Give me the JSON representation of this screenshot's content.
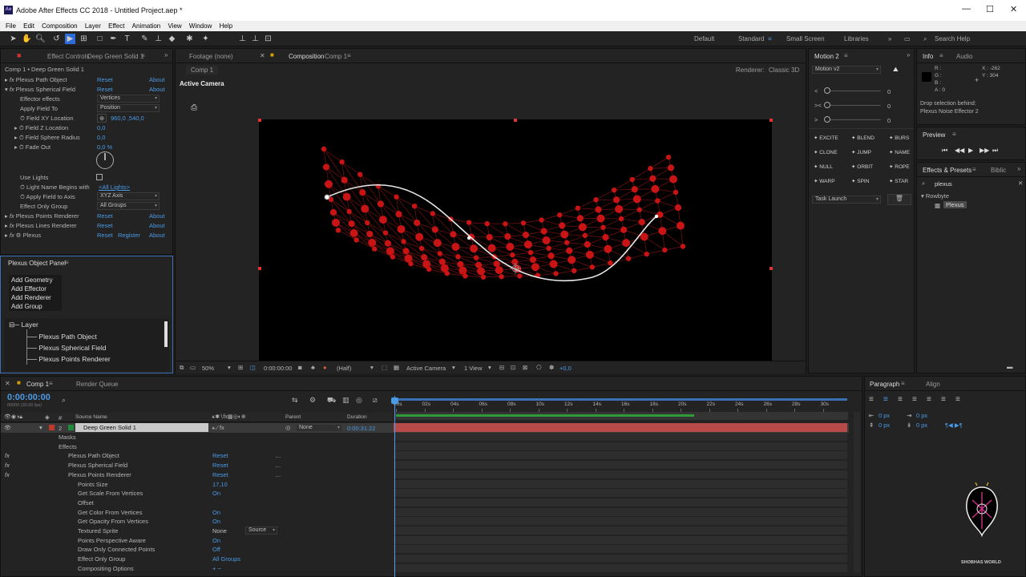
{
  "app": {
    "title": "Adobe After Effects CC 2018 - Untitled Project.aep *",
    "logo": "Ae"
  },
  "menu": [
    "File",
    "Edit",
    "Composition",
    "Layer",
    "Effect",
    "Animation",
    "View",
    "Window",
    "Help"
  ],
  "workspaces": {
    "default": "Default",
    "standard": "Standard",
    "small_screen": "Small Screen",
    "libraries": "Libraries",
    "search_help": "Search Help"
  },
  "effect_controls": {
    "tab_label": "Effect Controls",
    "layer_name": "Deep Green Solid 1",
    "breadcrumb": "Comp 1 • Deep Green Solid 1",
    "effects": [
      {
        "name": "Plexus Path Object",
        "reset": "Reset",
        "about": "About"
      },
      {
        "name": "Plexus Spherical Field",
        "reset": "Reset",
        "about": "About"
      }
    ],
    "props": {
      "effector_effects": {
        "label": "Effector effects",
        "value": "Vertices"
      },
      "apply_field_to": {
        "label": "Apply Field To",
        "value": "Position"
      },
      "field_xy": {
        "label": "Field XY Location",
        "value": "960,0 ,540,0"
      },
      "field_z": {
        "label": "Field Z Location",
        "value": "0,0"
      },
      "field_radius": {
        "label": "Field Sphere Radius",
        "value": "0,0"
      },
      "fade_out": {
        "label": "Fade Out",
        "value": "0,0 %"
      },
      "use_lights": {
        "label": "Use Lights"
      },
      "light_name": {
        "label": "Light Name Begins with",
        "value": "<All Lights>"
      },
      "apply_axis": {
        "label": "Apply Field to Axis",
        "value": "XYZ Axis"
      },
      "effect_only_group": {
        "label": "Effect Only Group",
        "value": "All Groups"
      }
    },
    "effects_after": [
      {
        "name": "Plexus Points Renderer",
        "reset": "Reset",
        "about": "About"
      },
      {
        "name": "Plexus Lines Renderer",
        "reset": "Reset",
        "about": "About"
      },
      {
        "name": "Plexus",
        "reset": "Reset",
        "register": "Register",
        "about": "About"
      }
    ]
  },
  "plexus_panel": {
    "title": "Plexus Object Panel",
    "buttons": [
      "Add Geometry",
      "Add Effector",
      "Add Renderer",
      "Add Group"
    ],
    "tree_root": "Layer",
    "tree_items": [
      "Plexus Path Object",
      "Plexus Spherical Field",
      "Plexus Points Renderer"
    ]
  },
  "composition": {
    "footage_tab": "Footage (none)",
    "comp_tab_prefix": "Composition",
    "comp_tab_name": "Comp 1",
    "comp_crumb": "Comp 1",
    "renderer_label": "Renderer:",
    "renderer_value": "Classic 3D",
    "camera_label": "Active Camera",
    "zoom": "50%",
    "timecode": "0:00:00:00",
    "resolution": "(Half)",
    "camera": "Active Camera",
    "view": "1 View",
    "exposure": "+0,0"
  },
  "motion": {
    "title": "Motion 2",
    "preset": "Motion v2",
    "sliders": [
      {
        "label": "<",
        "value": "0"
      },
      {
        "label": "><",
        "value": "0"
      },
      {
        "label": ">",
        "value": "0"
      }
    ],
    "buttons": [
      [
        "EXCITE",
        "BLEND",
        "BURS"
      ],
      [
        "CLONE",
        "JUMP",
        "NAME"
      ],
      [
        "NULL",
        "ORBIT",
        "ROPE"
      ],
      [
        "WARP",
        "SPIN",
        "STAR"
      ]
    ],
    "task": "Task Launch"
  },
  "info": {
    "tab": "Info",
    "audio_tab": "Audio",
    "r": "R :",
    "g": "G :",
    "b": "B :",
    "a": "A : 0",
    "x": "X : -262",
    "y": "Y : 304",
    "msg1": "Drop selection behind:",
    "msg2": "Plexus Noise Effector 2"
  },
  "preview": {
    "title": "Preview"
  },
  "effects_presets": {
    "title": "Effects & Presets",
    "lib_tab": "Biblic",
    "search": "plexus",
    "category": "Rowbyte",
    "item": "Plexus"
  },
  "timeline": {
    "tab": "Comp 1",
    "render_queue": "Render Queue",
    "timecode": "0:00:00:00",
    "fps": "00000 (30.00 fps)",
    "cols": {
      "source": "Source Name",
      "parent": "Parent",
      "duration": "Duration"
    },
    "ruler": [
      "00s",
      "02s",
      "04s",
      "06s",
      "08s",
      "10s",
      "12s",
      "14s",
      "16s",
      "18s",
      "20s",
      "22s",
      "24s",
      "26s",
      "28s",
      "30s"
    ],
    "layer": {
      "num": "2",
      "name": "Deep Green Solid 1",
      "parent": "None",
      "duration": "0:00:31:22"
    },
    "rows": [
      {
        "label": "Masks",
        "indent": 1
      },
      {
        "label": "Effects",
        "indent": 1
      },
      {
        "label": "Plexus Path Object",
        "indent": 2,
        "val": "Reset",
        "fx": true
      },
      {
        "label": "Plexus Spherical Field",
        "indent": 2,
        "val": "Reset",
        "fx": true
      },
      {
        "label": "Plexus Points Renderer",
        "indent": 2,
        "val": "Reset",
        "fx": true
      },
      {
        "label": "Points Size",
        "indent": 3,
        "val": "17,10"
      },
      {
        "label": "Get Scale From Vertices",
        "indent": 3,
        "val": "On"
      },
      {
        "label": "Offset",
        "indent": 3,
        "val": ""
      },
      {
        "label": "Get Color From Vertices",
        "indent": 3,
        "val": "On"
      },
      {
        "label": "Get Opacity From Vertices",
        "indent": 3,
        "val": "On"
      },
      {
        "label": "Textured Sprite",
        "indent": 3,
        "val": "None"
      },
      {
        "label": "Points Perspective Aware",
        "indent": 3,
        "val": "On"
      },
      {
        "label": "Draw Only Connected Points",
        "indent": 3,
        "val": "Off"
      },
      {
        "label": "Effect Only Group",
        "indent": 3,
        "val": "All Groups"
      },
      {
        "label": "Compositing Options",
        "indent": 3,
        "val": "+ −"
      }
    ],
    "source_dd": "Source"
  },
  "paragraph": {
    "tab": "Paragraph",
    "align_tab": "Align",
    "px": "0 px"
  },
  "watermark": "SHOBHAS WORLD"
}
